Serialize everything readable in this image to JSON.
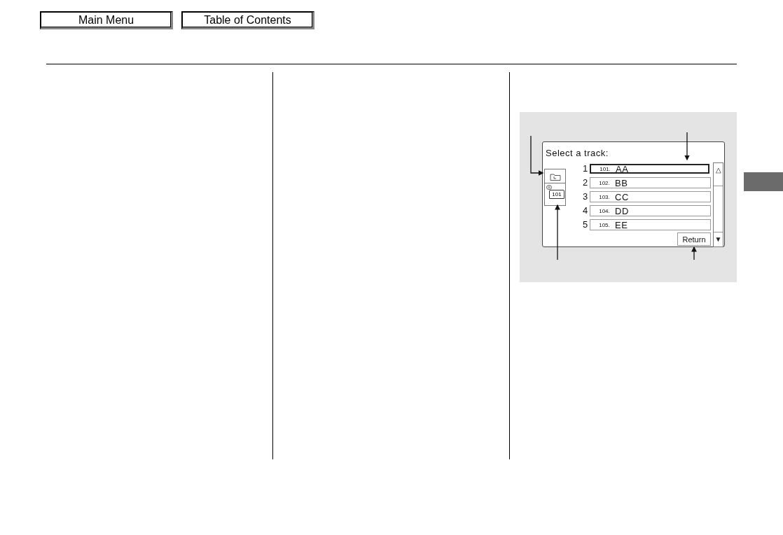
{
  "nav_buttons": [
    {
      "label": "Main Menu"
    },
    {
      "label": "Table of Contents"
    }
  ],
  "figure": {
    "screen_title": "Select a track:",
    "folder_label": "101",
    "tracks": [
      {
        "number": "1",
        "code": "101.",
        "name": "AA",
        "selected": true
      },
      {
        "number": "2",
        "code": "102.",
        "name": "BB",
        "selected": false
      },
      {
        "number": "3",
        "code": "103.",
        "name": "CC",
        "selected": false
      },
      {
        "number": "4",
        "code": "104.",
        "name": "DD",
        "selected": false
      },
      {
        "number": "5",
        "code": "105.",
        "name": "EE",
        "selected": false
      }
    ],
    "scroll_up": "△",
    "scroll_down": "▼",
    "return_button": "Return"
  }
}
